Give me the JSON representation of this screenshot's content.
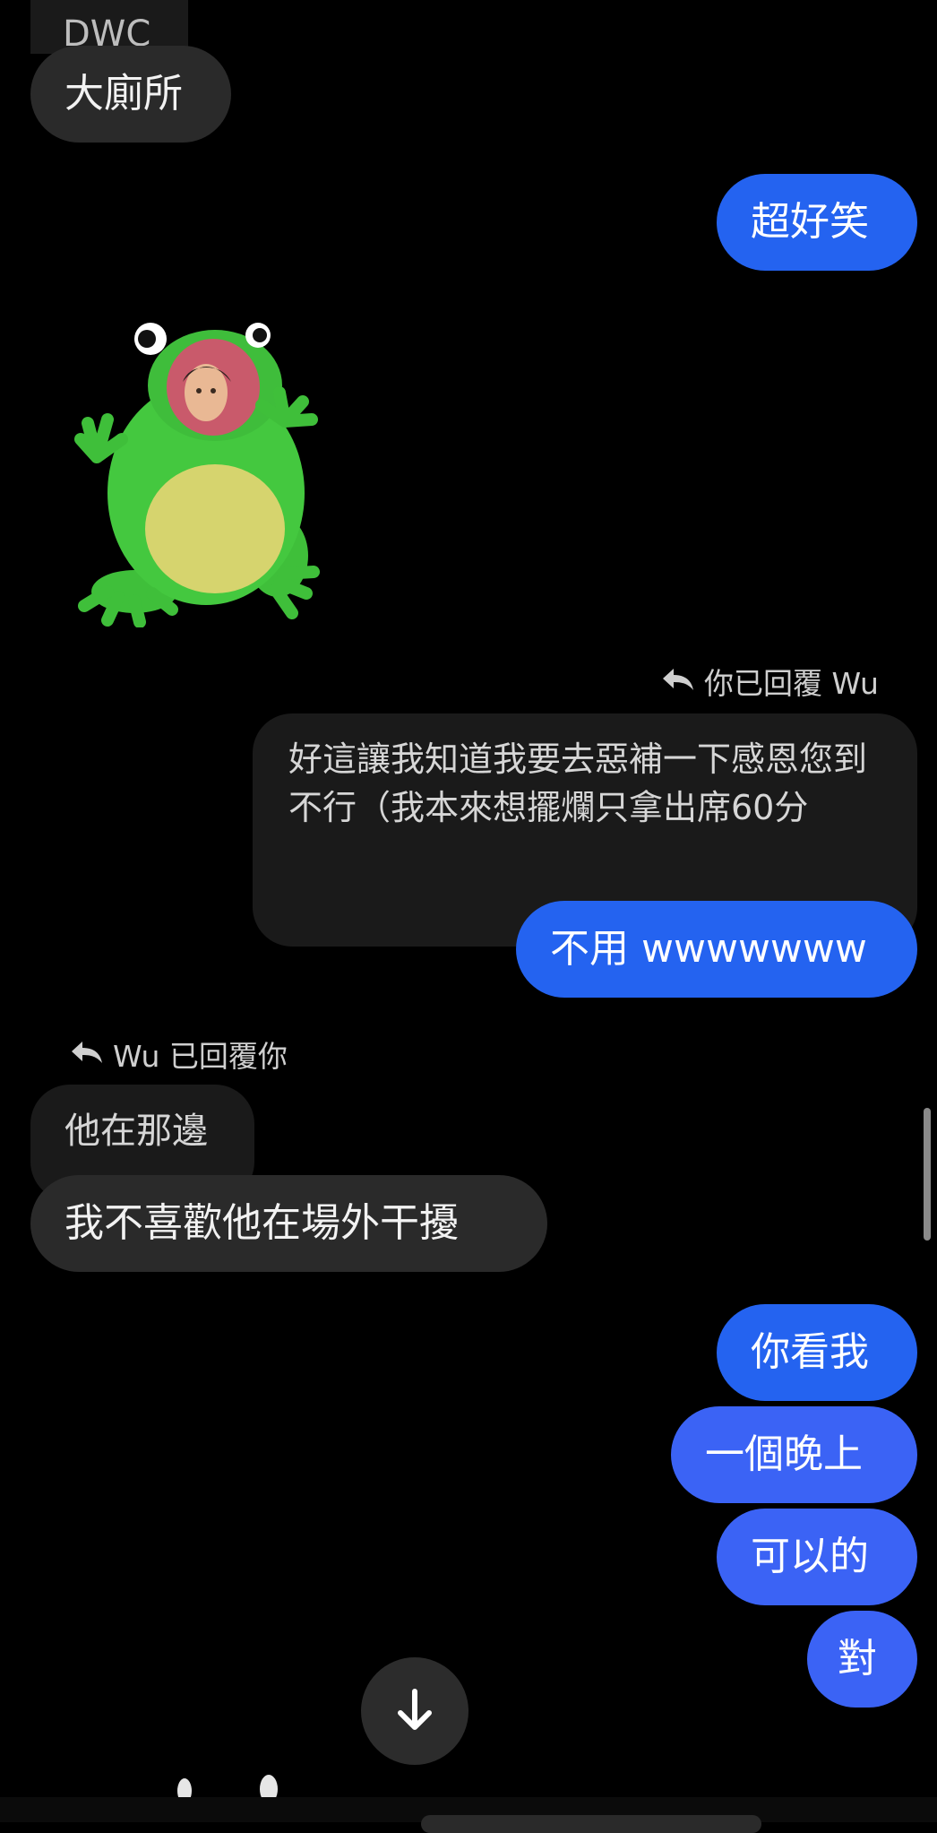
{
  "messages": {
    "top_partial": "DWC",
    "m1": "大廁所",
    "m2": "超好笑",
    "sticker": "frog-sticker",
    "reply1_label": "你已回覆 Wu",
    "quoted_text": "好這讓我知道我要去惡補一下感恩您到不行（我本來想擺爛只拿出席60分",
    "m3": "不用 wwwwwww",
    "reply2_label": "Wu 已回覆你",
    "quoted2_text": "他在那邊",
    "m4": "我不喜歡他在場外干擾",
    "m5": "你看我",
    "m6": "一個晚上",
    "m7": "可以的",
    "m8": "對"
  },
  "colors": {
    "outgoing": "#2463f0",
    "incoming": "#2a2a2a",
    "background": "#000000"
  },
  "icons": {
    "reply": "reply-arrow-icon",
    "scroll": "arrow-down-icon"
  }
}
